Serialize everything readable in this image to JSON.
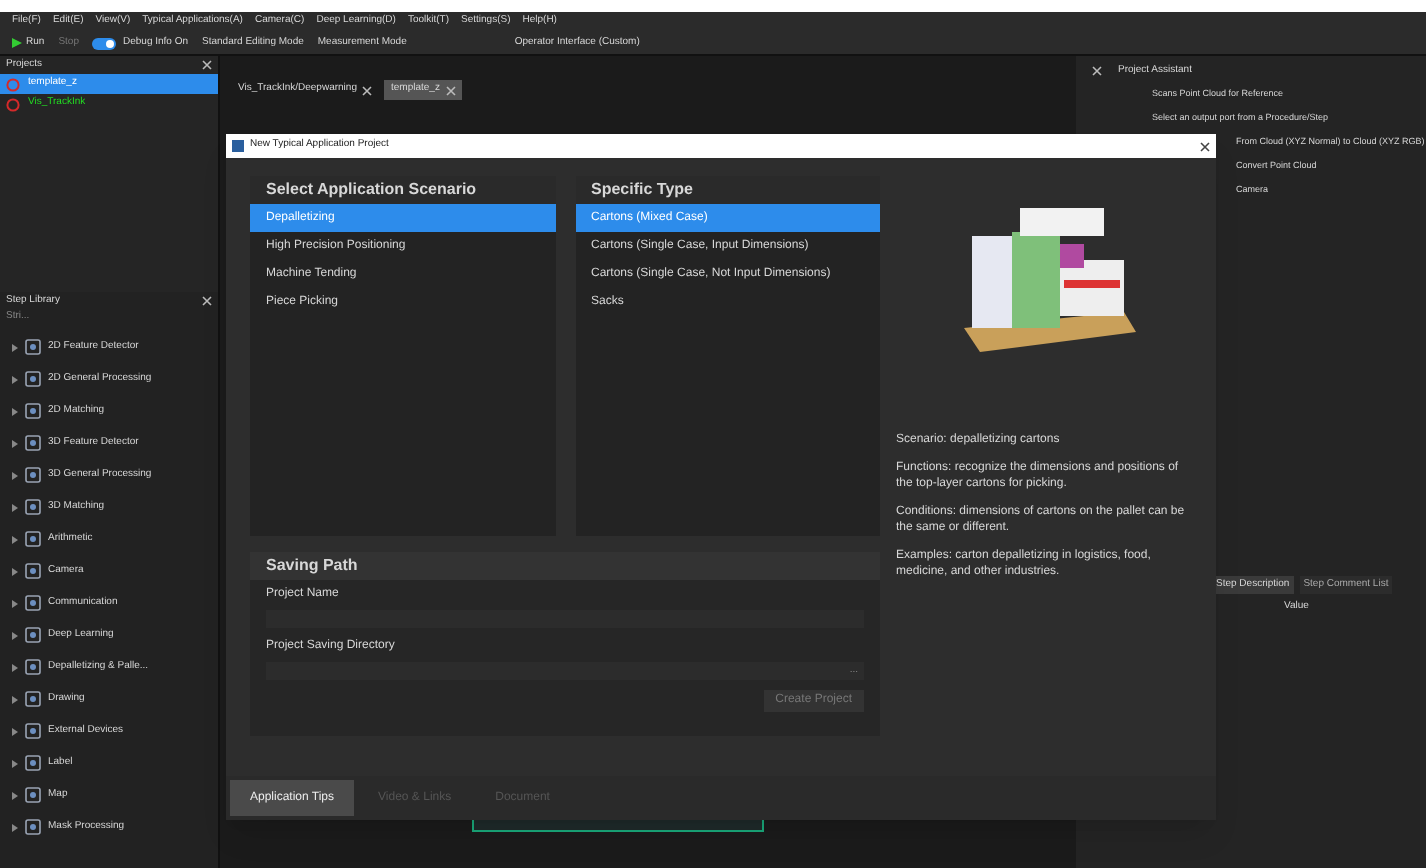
{
  "menu": [
    "File(F)",
    "Edit(E)",
    "View(V)",
    "Typical Applications(A)",
    "Camera(C)",
    "Deep Learning(D)",
    "Toolkit(T)",
    "Settings(S)",
    "Help(H)"
  ],
  "toolbar": {
    "run": "Run",
    "stop": "Stop",
    "debug": {
      "label": "Debug Info On",
      "on": true
    },
    "modes": [
      "Standard Editing Mode",
      "Measurement Mode"
    ],
    "operator": "Operator Interface (Custom)"
  },
  "projects": {
    "title": "Projects",
    "items": [
      {
        "label": "template_z",
        "selected": true
      },
      {
        "label": "Vis_TrackInk",
        "selected": false
      }
    ]
  },
  "step_library": {
    "title": "Step Library",
    "search": "Stri...",
    "items": [
      "2D Feature Detector",
      "2D General Processing",
      "2D Matching",
      "3D Feature Detector",
      "3D General Processing",
      "3D Matching",
      "Arithmetic",
      "Camera",
      "Communication",
      "Deep Learning",
      "Depalletizing & Palle...",
      "Drawing",
      "External Devices",
      "Label",
      "Map",
      "Mask Processing"
    ]
  },
  "editor_tabs": [
    {
      "label": "Vis_TrackInk/Deepwarning",
      "selected": false
    },
    {
      "label": "template_z",
      "selected": true
    }
  ],
  "assistant": {
    "title": "Project Assistant",
    "rows": [
      "Scans Point Cloud for Reference",
      "Select an output port from a Procedure/Step",
      "From Cloud (XYZ Normal) to Cloud (XYZ RGB)",
      "Convert Point Cloud",
      "Camera"
    ],
    "tabs": [
      {
        "label": "Step Description",
        "selected": true
      },
      {
        "label": "Step Comment List",
        "selected": false
      }
    ],
    "value_header": "Value"
  },
  "dialog": {
    "title": "New Typical Application Project",
    "scenario_header": "Select Application Scenario",
    "scenarios": [
      {
        "label": "Depalletizing",
        "selected": true
      },
      {
        "label": "High Precision Positioning",
        "selected": false
      },
      {
        "label": "Machine Tending",
        "selected": false
      },
      {
        "label": "Piece Picking",
        "selected": false
      }
    ],
    "type_header": "Specific Type",
    "types": [
      {
        "label": "Cartons (Mixed Case)",
        "selected": true
      },
      {
        "label": "Cartons (Single Case, Input Dimensions)",
        "selected": false
      },
      {
        "label": "Cartons (Single Case, Not Input Dimensions)",
        "selected": false
      },
      {
        "label": "Sacks",
        "selected": false
      }
    ],
    "description": [
      "Scenario: depalletizing cartons",
      "Functions: recognize the dimensions and positions of the top-layer cartons for picking.",
      "Conditions: dimensions of cartons on the pallet can be the same or different.",
      "Examples: carton depalletizing in logistics, food, medicine, and other industries."
    ],
    "saving_header": "Saving Path",
    "project_name_label": "Project Name",
    "directory_label": "Project Saving Directory",
    "browse": "...",
    "create": "Create Project",
    "footer_tabs": [
      {
        "label": "Application Tips",
        "selected": true
      },
      {
        "label": "Video & Links",
        "selected": false
      },
      {
        "label": "Document",
        "selected": false
      }
    ]
  }
}
